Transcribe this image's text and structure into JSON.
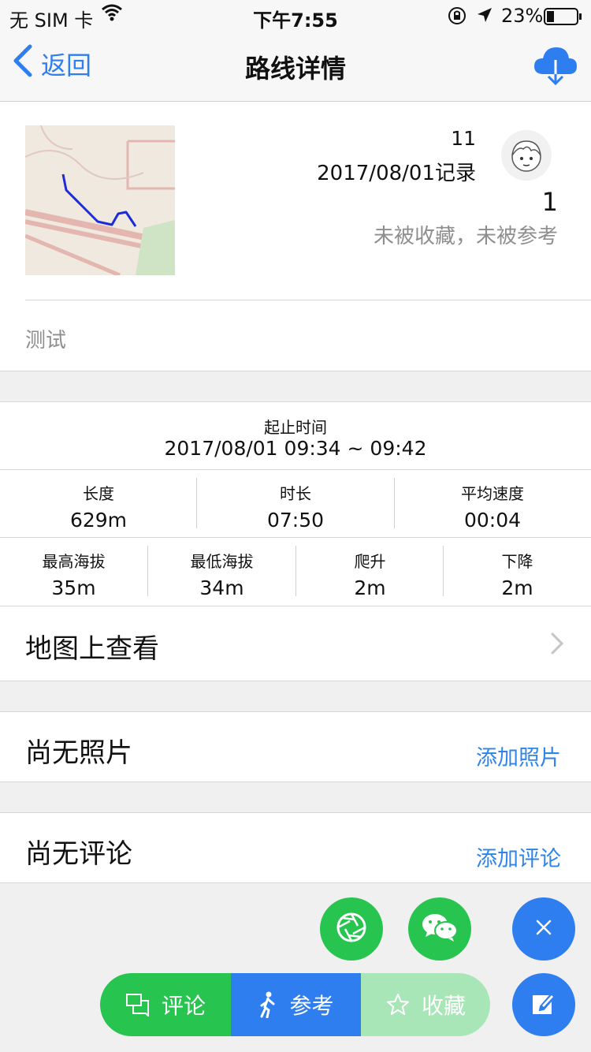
{
  "status_bar": {
    "carrier": "无 SIM 卡",
    "time": "下午7:55",
    "battery": "23%"
  },
  "nav": {
    "back_label": "返回",
    "title": "路线详情",
    "download_icon": "cloud-download-icon"
  },
  "summary": {
    "number": "11",
    "record_date": "2017/08/01记录",
    "count": "1",
    "collect_status": "未被收藏，未被参考",
    "description": "测试"
  },
  "time_range": {
    "label": "起止时间",
    "value": "2017/08/01 09:34 ~ 09:42"
  },
  "metrics_row1": [
    {
      "label": "长度",
      "value": "629m"
    },
    {
      "label": "时长",
      "value": "07:50"
    },
    {
      "label": "平均速度",
      "value": "00:04"
    }
  ],
  "metrics_row2": [
    {
      "label": "最高海拔",
      "value": "35m"
    },
    {
      "label": "最低海拔",
      "value": "34m"
    },
    {
      "label": "爬升",
      "value": "2m"
    },
    {
      "label": "下降",
      "value": "2m"
    }
  ],
  "map_link": {
    "label": "地图上查看"
  },
  "photos": {
    "title": "尚无照片",
    "action": "添加照片"
  },
  "comments": {
    "title": "尚无评论",
    "action": "添加评论"
  },
  "actions": {
    "comment": "评论",
    "reference": "参考",
    "favorite": "收藏"
  },
  "colors": {
    "accent_blue": "#2f7ef0",
    "green": "#27c54f",
    "light_green": "#a8e6b8"
  }
}
